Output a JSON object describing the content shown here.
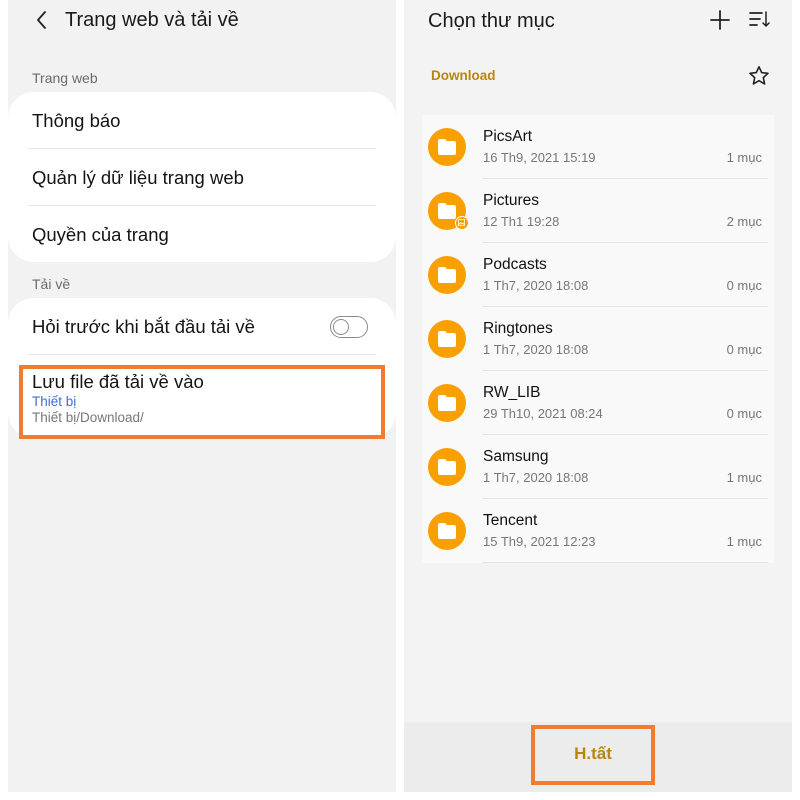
{
  "left": {
    "header": {
      "title": "Trang web và tải về"
    },
    "section_web": "Trang web",
    "web_items": [
      "Thông báo",
      "Quản lý dữ liệu trang web",
      "Quyền của trang"
    ],
    "section_download": "Tải về",
    "ask_before_download": {
      "label": "Hỏi trước khi bắt đầu tải về",
      "enabled": false
    },
    "save_location": {
      "title": "Lưu file đã tải về vào",
      "storage": "Thiết bị",
      "path": "Thiết bị/Download/"
    }
  },
  "right": {
    "header": {
      "title": "Chọn thư mục",
      "icons": [
        "plus-icon",
        "sort-icon"
      ]
    },
    "current_path": "Download",
    "folders": [
      {
        "name": "PicsArt",
        "date": "16 Th9, 2021 15:19",
        "count": "1 mục"
      },
      {
        "name": "Pictures",
        "date": "12 Th1 19:28",
        "count": "2 mục",
        "badge": "image-icon"
      },
      {
        "name": "Podcasts",
        "date": "1 Th7, 2020 18:08",
        "count": "0 mục"
      },
      {
        "name": "Ringtones",
        "date": "1 Th7, 2020 18:08",
        "count": "0 mục"
      },
      {
        "name": "RW_LIB",
        "date": "29 Th10, 2021 08:24",
        "count": "0 mục"
      },
      {
        "name": "Samsung",
        "date": "1 Th7, 2020 18:08",
        "count": "1 mục"
      },
      {
        "name": "Tencent",
        "date": "15 Th9, 2021 12:23",
        "count": "1 mục"
      }
    ],
    "done_label": "H.tất"
  },
  "colors": {
    "accent": "#b9860d",
    "folder": "#f7a000",
    "highlight": "#f07d2f",
    "link_blue": "#3e6fd0"
  }
}
